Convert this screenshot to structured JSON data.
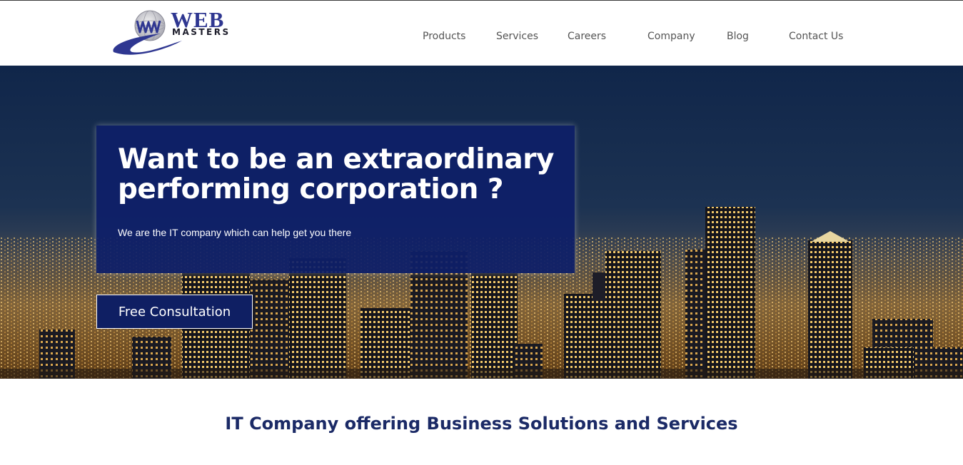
{
  "brand": {
    "logo_top": "WEB",
    "logo_bottom": "MASTERS",
    "primary_color": "#2f3791",
    "dark_color": "#0f1f63"
  },
  "nav": {
    "items": [
      {
        "label": "Products"
      },
      {
        "label": "Services"
      },
      {
        "label": "Careers"
      },
      {
        "label": "Company"
      },
      {
        "label": "Blog"
      },
      {
        "label": "Contact Us"
      }
    ]
  },
  "hero": {
    "title_line1": "Want to be an extraordinary",
    "title_line2": "performing corporation ?",
    "subtitle": "We are the IT company which can help get you there",
    "cta_label": "Free Consultation",
    "card_color": "#0e1f68"
  },
  "section": {
    "title": "IT Company offering Business Solutions and Services"
  }
}
